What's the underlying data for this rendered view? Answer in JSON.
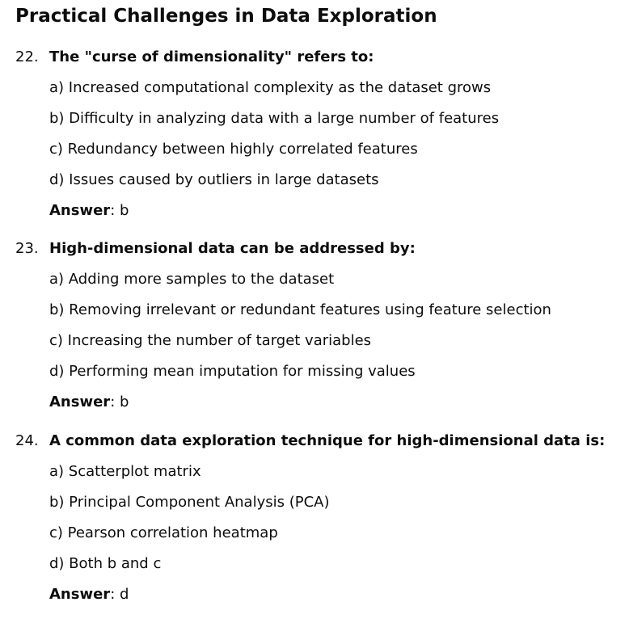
{
  "title": "Practical Challenges in Data Exploration",
  "questions": [
    {
      "number": "22.",
      "text": "The \"curse of dimensionality\" refers to:",
      "options": [
        "a) Increased computational complexity as the dataset grows",
        "b) Difficulty in analyzing data with a large number of features",
        "c) Redundancy between highly correlated features",
        "d) Issues caused by outliers in large datasets"
      ],
      "answer_label": "Answer",
      "answer_value": ": b"
    },
    {
      "number": "23.",
      "text": "High-dimensional data can be addressed by:",
      "options": [
        "a) Adding more samples to the dataset",
        "b) Removing irrelevant or redundant features using feature selection",
        "c) Increasing the number of target variables",
        "d) Performing mean imputation for missing values"
      ],
      "answer_label": "Answer",
      "answer_value": ": b"
    },
    {
      "number": "24.",
      "text": "A common data exploration technique for high-dimensional data is:",
      "options": [
        "a) Scatterplot matrix",
        "b) Principal Component Analysis (PCA)",
        "c) Pearson correlation heatmap",
        "d) Both b and c"
      ],
      "answer_label": "Answer",
      "answer_value": ": d"
    }
  ]
}
